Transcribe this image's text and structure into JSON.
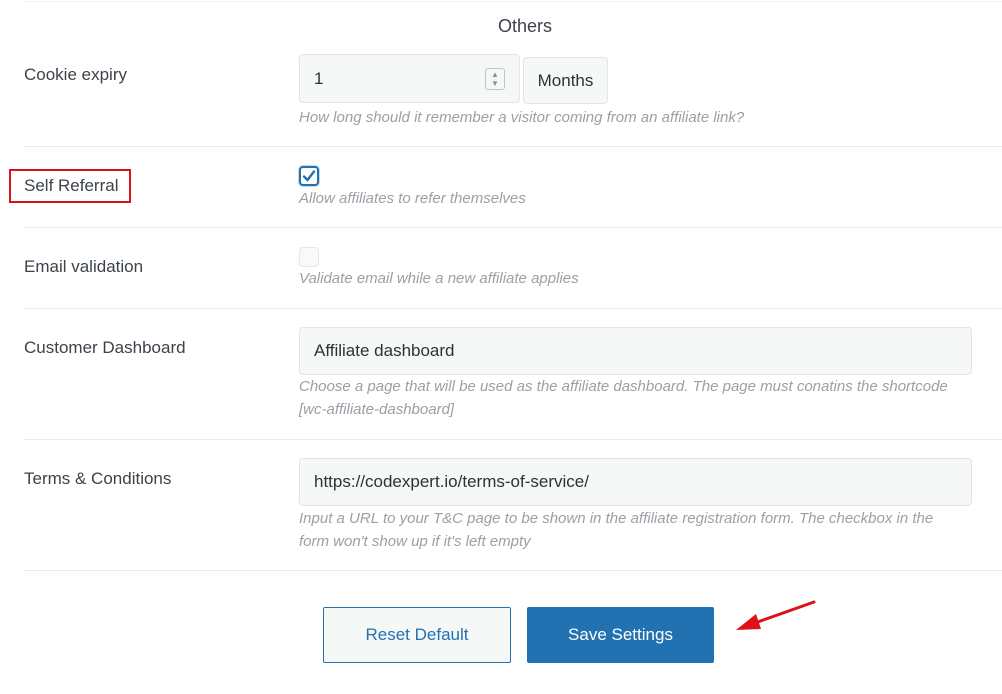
{
  "section": {
    "title": "Others"
  },
  "cookie_expiry": {
    "label": "Cookie expiry",
    "value": "1",
    "unit": "Months",
    "description": "How long should it remember a visitor coming from an affiliate link?"
  },
  "self_referral": {
    "label": "Self Referral",
    "checked": true,
    "description": "Allow affiliates to refer themselves",
    "highlight_color": "#e0101a"
  },
  "email_validation": {
    "label": "Email validation",
    "checked": false,
    "description": "Validate email while a new affiliate applies"
  },
  "customer_dashboard": {
    "label": "Customer Dashboard",
    "value": "Affiliate dashboard",
    "description_line1": "Choose a page that will be used as the affiliate dashboard. The page must conatins the shortcode",
    "description_line2": "[wc-affiliate-dashboard]"
  },
  "terms": {
    "label": "Terms & Conditions",
    "value": "https://codexpert.io/terms-of-service/",
    "description_line1": "Input a URL to your T&C page to be shown in the affiliate registration form. The checkbox in the",
    "description_line2": "form won't show up if it's left empty"
  },
  "actions": {
    "reset_label": "Reset Default",
    "save_label": "Save Settings"
  },
  "colors": {
    "accent": "#2271b1",
    "annotation": "#e0101a"
  },
  "icons": {
    "checkmark": "check-icon",
    "spinner_up": "chevron-up-icon",
    "spinner_down": "chevron-down-icon",
    "annotation_arrow": "arrow-pointer-icon"
  }
}
